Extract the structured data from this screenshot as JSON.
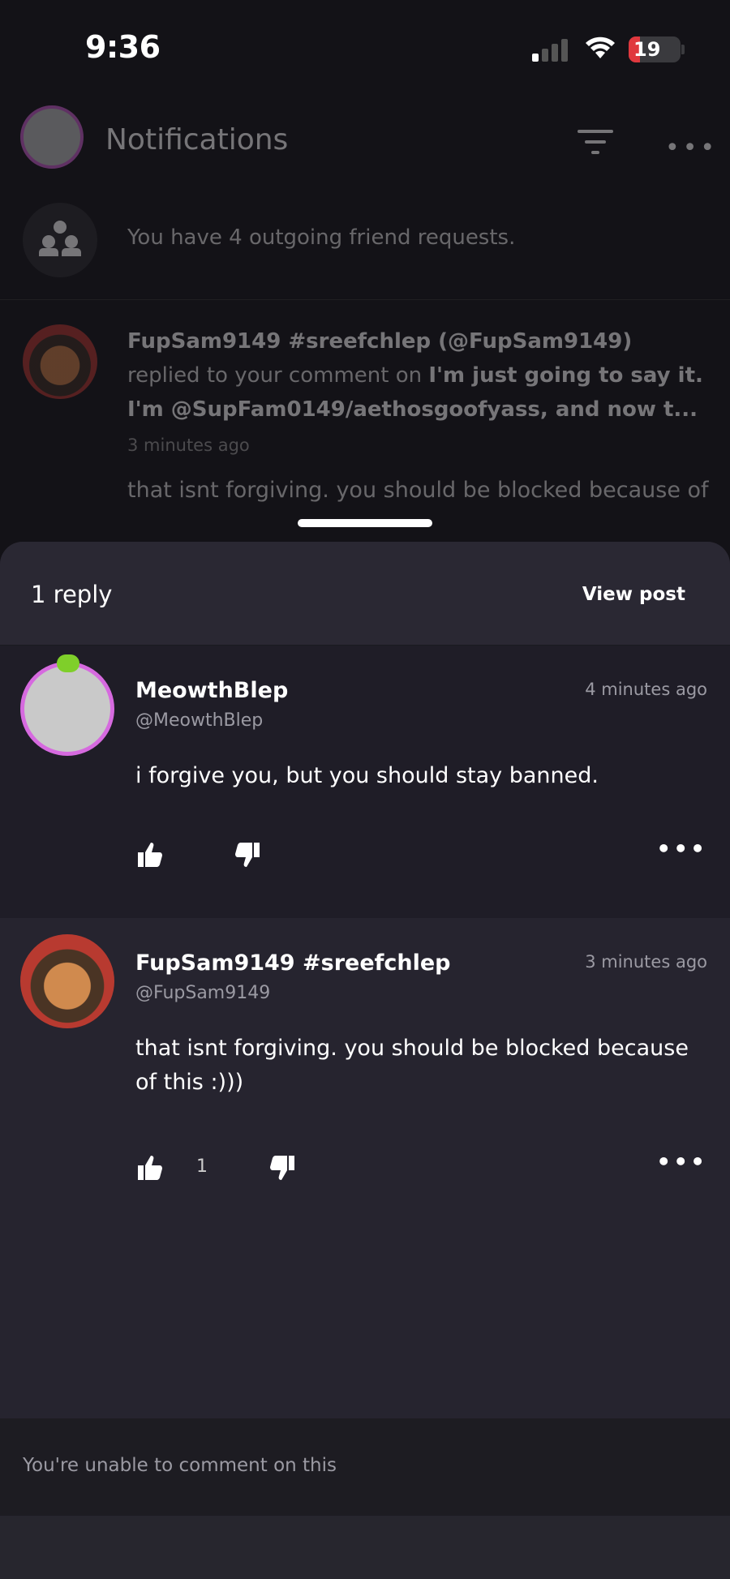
{
  "status": {
    "time": "9:36",
    "battery": "19"
  },
  "header": {
    "title": "Notifications"
  },
  "friend_requests": {
    "text": "You have 4 outgoing friend requests."
  },
  "notification": {
    "user": "FupSam9149 #sreefchlep (@FupSam9149)",
    "action": "replied to your comment on",
    "post": "I'm just going to say it. I'm @SupFam0149/aethosgoofyass, and now t...",
    "ago": "3 minutes ago",
    "preview": "that isnt forgiving. you should be blocked because of this :)))"
  },
  "sheet": {
    "reply_count": "1 reply",
    "view_post": "View post"
  },
  "comments": [
    {
      "name": "MeowthBlep",
      "handle": "@MeowthBlep",
      "time": "4 minutes ago",
      "text": "i forgive you, but you should stay banned.",
      "likes": ""
    },
    {
      "name": "FupSam9149 #sreefchlep",
      "handle": "@FupSam9149",
      "time": "3 minutes ago",
      "text": "that isnt forgiving. you should be blocked because of this :)))",
      "likes": "1"
    }
  ],
  "footer": {
    "message": "You're unable to comment on this"
  }
}
